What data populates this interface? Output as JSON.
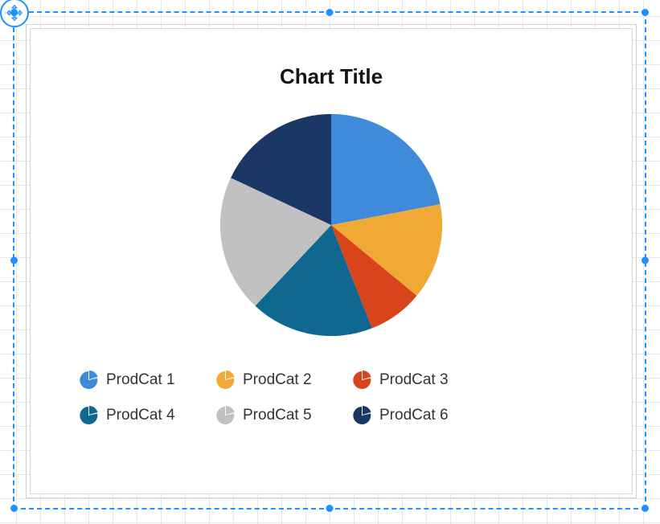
{
  "chart_data": {
    "type": "pie",
    "title": "Chart Title",
    "series": [
      {
        "name": "ProdCat 1",
        "value": 22,
        "color": "#3f8bd9"
      },
      {
        "name": "ProdCat 2",
        "value": 14,
        "color": "#f0a935"
      },
      {
        "name": "ProdCat 3",
        "value": 8,
        "color": "#d8441b"
      },
      {
        "name": "ProdCat 4",
        "value": 18,
        "color": "#0e6890"
      },
      {
        "name": "ProdCat 5",
        "value": 20,
        "color": "#c1c1c1"
      },
      {
        "name": "ProdCat 6",
        "value": 18,
        "color": "#1a3766"
      }
    ]
  },
  "selection": {
    "color": "#1e90ff"
  }
}
